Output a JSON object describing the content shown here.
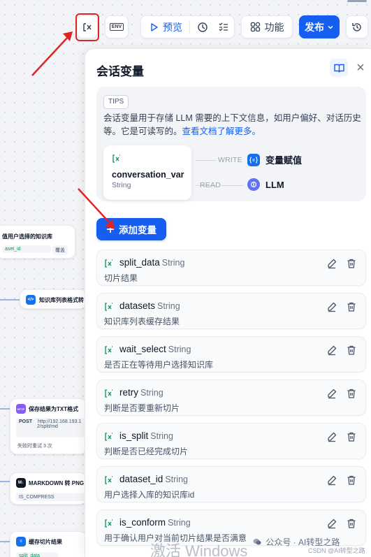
{
  "toolbar": {
    "preview_label": "预览",
    "features_label": "功能",
    "publish_label": "发布",
    "env_label": "ENV"
  },
  "panel": {
    "title": "会话变量",
    "close_glyph": "×",
    "tips": {
      "tag": "TIPS",
      "text": "会话变量用于存储 LLM 需要的上下文信息，如用户偏好、对话历史等。它是可读写的。",
      "link": "查看文档了解更多。"
    },
    "example": {
      "name": "conversation_var",
      "type": "String",
      "write_label": "WRITE",
      "read_label": "READ",
      "write_target": "变量赋值",
      "read_target": "LLM"
    },
    "add_button": "添加变量",
    "variables": [
      {
        "name": "split_data",
        "type": "String",
        "description": "切片结果"
      },
      {
        "name": "datasets",
        "type": "String",
        "description": "知识库列表缓存结果"
      },
      {
        "name": "wait_select",
        "type": "String",
        "description": "是否正在等待用户选择知识库"
      },
      {
        "name": "retry",
        "type": "String",
        "description": "判断是否要重新切片"
      },
      {
        "name": "is_split",
        "type": "String",
        "description": "判断是否已经完成切片"
      },
      {
        "name": "dataset_id",
        "type": "String",
        "description": "用户选择入库的知识库id"
      },
      {
        "name": "is_conform",
        "type": "String",
        "description": "用于确认用户对当前切片结果是否满意"
      }
    ]
  },
  "canvas": {
    "node1_title": "值用户选择的知识库",
    "node1_chip": "aset_id",
    "node1_chip2": "覆盖",
    "node2_title": "知识库列表格式转",
    "node3_title": "保存结果为TXT格式",
    "node3_method": "POST",
    "node3_url": "http://192.168.193.1",
    "node3_url2": "2/split/md",
    "node3_retry": "失败时重试 3 次",
    "node4_title": "MARKDOWN 转 PNG",
    "node4_chip": "IS_COMPRESS",
    "node5_title": "缓存切片结果",
    "node5_chip": "split_data",
    "node3_icon": "HTTP",
    "node4_icon": "M↓"
  },
  "watermark": {
    "text": "公众号 · AI转型之路",
    "activate": "激活 Windows",
    "csdn": "CSDN @AI转型之路"
  },
  "colors": {
    "accent": "#155eef",
    "annotation": "#e02424",
    "variable_icon": "#079455"
  }
}
